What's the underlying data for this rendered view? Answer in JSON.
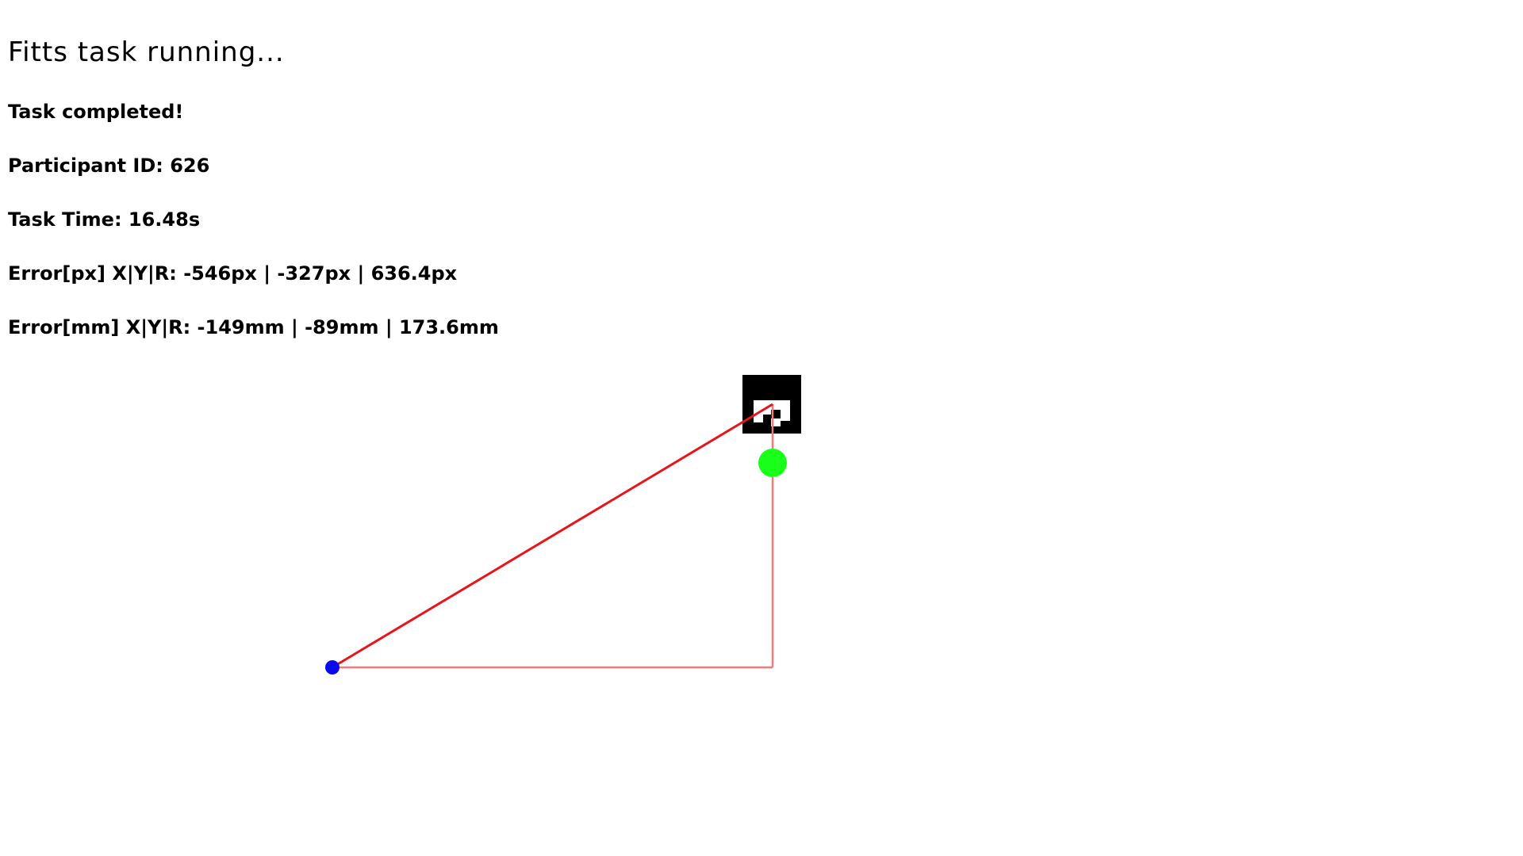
{
  "hud": {
    "title": "Fitts task running...",
    "status": "Task completed!",
    "participant": "Participant ID: 626",
    "task_time": "Task Time: 16.48s",
    "error_px": "Error[px] X|Y|R: -546px | -327px | 636.4px",
    "error_mm": "Error[mm] X|Y|R: -149mm | -89mm | 173.6mm"
  },
  "colors": {
    "background": "#ffffff",
    "text": "#000000",
    "error_line": "#e8141c",
    "component_lines": "#f47a7a",
    "target_dot": "#1aff1a",
    "cursor_dot": "#0a0af0",
    "marker_bg": "#000000",
    "marker_fg": "#ffffff"
  },
  "icons": {
    "marker": "fiducial-marker-icon",
    "target": "green-target-dot",
    "cursor": "blue-cursor-dot"
  }
}
